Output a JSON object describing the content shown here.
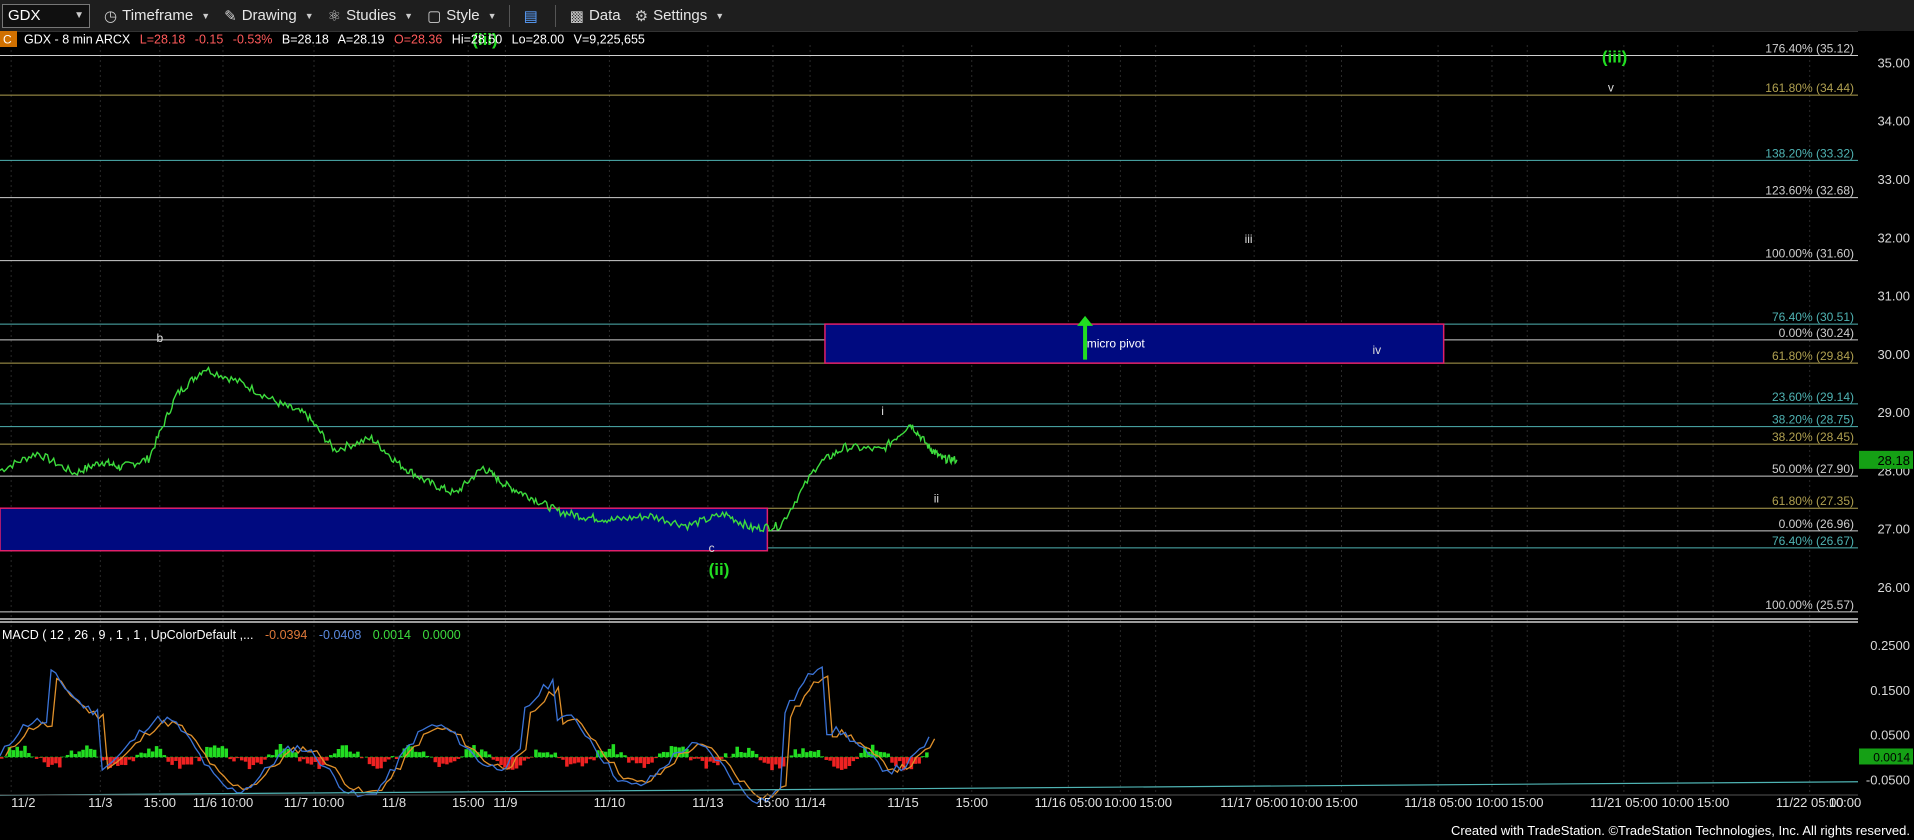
{
  "toolbar": {
    "symbol": "GDX",
    "items": [
      {
        "icon": "clock-icon",
        "label": "Timeframe"
      },
      {
        "icon": "pencil-icon",
        "label": "Drawing"
      },
      {
        "icon": "flask-icon",
        "label": "Studies"
      },
      {
        "icon": "style-icon",
        "label": "Style"
      },
      {
        "icon": "layout-icon",
        "label": ""
      },
      {
        "icon": "bar-chart-icon",
        "label": "Data"
      },
      {
        "icon": "gear-icon",
        "label": "Settings"
      }
    ]
  },
  "header": {
    "badge": "C",
    "symbol_text": "GDX - 8 min  ARCX",
    "last": "L=28.18",
    "change": "-0.15",
    "change_pct": "-0.53%",
    "bid": "B=28.18",
    "ask": "A=28.19",
    "open": "O=28.36",
    "high": "Hi=28.50",
    "low": "Lo=28.00",
    "volume": "V=9,225,655"
  },
  "macd": {
    "title": "MACD ( 12 , 26 , 9 , 1 , 1 , UpColorDefault ,...",
    "v1": "-0.0394",
    "v2": "-0.0408",
    "v3": "0.0014",
    "v4": "0.0000",
    "current_label": "0.0014",
    "ticks": [
      "0.2500",
      "0.1500",
      "0.0500",
      "-0.0500"
    ],
    "tick_values": [
      0.25,
      0.15,
      0.05,
      -0.05
    ]
  },
  "footer": "Created with TradeStation. ©TradeStation Technologies, Inc. All rights reserved.",
  "colors": {
    "price": "#3ddc3d",
    "macd_pos": "#22dd22",
    "macd_neg": "#ee2222",
    "macd_line": "#3b74d8",
    "signal_line": "#e0902a",
    "zone_fill": "#000a80",
    "zone_border": "#e0206a",
    "fib_teal": "#4fb3b3",
    "fib_gold": "#b0a050",
    "fib_white": "#cfcfcf"
  },
  "chart_data": {
    "type": "line",
    "title": "GDX - 8 min",
    "current_price": 28.18,
    "current_price_label": "28.18",
    "ylim": [
      25.5,
      35.3
    ],
    "y_ticks": [
      26.0,
      27.0,
      28.0,
      29.0,
      30.0,
      31.0,
      32.0,
      33.0,
      34.0,
      35.0
    ],
    "y_tick_labels": [
      "26.00",
      "27.00",
      "28.00",
      "29.00",
      "30.00",
      "31.00",
      "32.00",
      "33.00",
      "34.00",
      "35.00"
    ],
    "x_tick_labels": [
      "11/2",
      "11/3",
      "15:00",
      "11/6 10:00",
      "11/7 10:00",
      "11/8",
      "15:00",
      "11/9",
      "11/10",
      "11/13",
      "15:00",
      "11/14",
      "11/15",
      "15:00",
      "11/16 05:00",
      "10:00",
      "15:00",
      "11/17 05:00",
      "10:00",
      "15:00",
      "11/18 05:00",
      "10:00",
      "15:00",
      "11/21 05:00",
      "10:00",
      "15:00",
      "11/22 05:00",
      "10:00"
    ],
    "x_tick_positions": [
      0.006,
      0.054,
      0.086,
      0.12,
      0.169,
      0.212,
      0.252,
      0.272,
      0.328,
      0.381,
      0.416,
      0.436,
      0.486,
      0.523,
      0.575,
      0.603,
      0.622,
      0.675,
      0.703,
      0.722,
      0.774,
      0.803,
      0.822,
      0.874,
      0.903,
      0.922,
      0.974,
      1.003
    ],
    "series": [
      {
        "name": "GDX",
        "x": [
          0,
          0.02,
          0.04,
          0.055,
          0.065,
          0.08,
          0.095,
          0.11,
          0.13,
          0.15,
          0.165,
          0.18,
          0.2,
          0.215,
          0.23,
          0.245,
          0.26,
          0.272,
          0.285,
          0.3,
          0.315,
          0.33,
          0.35,
          0.37,
          0.39,
          0.405,
          0.42,
          0.44,
          0.455,
          0.475,
          0.49,
          0.5,
          0.507,
          0.515
        ],
        "y": [
          28.0,
          28.3,
          27.95,
          28.15,
          28.05,
          28.2,
          29.3,
          29.75,
          29.5,
          29.15,
          28.95,
          28.35,
          28.55,
          28.1,
          27.8,
          27.6,
          28.05,
          27.75,
          27.55,
          27.3,
          27.2,
          27.15,
          27.22,
          27.05,
          27.25,
          27.0,
          27.05,
          28.1,
          28.4,
          28.35,
          28.8,
          28.4,
          28.2,
          28.18
        ]
      }
    ],
    "fib_levels": [
      {
        "label": "176.40% (35.12)",
        "value": 35.12,
        "color": "fib_white"
      },
      {
        "label": "161.80% (34.44)",
        "value": 34.44,
        "color": "fib_gold"
      },
      {
        "label": "138.20% (33.32)",
        "value": 33.32,
        "color": "fib_teal"
      },
      {
        "label": "123.60% (32.68)",
        "value": 32.68,
        "color": "fib_white"
      },
      {
        "label": "100.00% (31.60)",
        "value": 31.6,
        "color": "fib_white"
      },
      {
        "label": "76.40% (30.51)",
        "value": 30.51,
        "color": "fib_teal"
      },
      {
        "label": "0.00% (30.24)",
        "value": 30.24,
        "color": "fib_white"
      },
      {
        "label": "61.80% (29.84)",
        "value": 29.84,
        "color": "fib_gold"
      },
      {
        "label": "23.60% (29.14)",
        "value": 29.14,
        "color": "fib_teal"
      },
      {
        "label": "38.20% (28.75)",
        "value": 28.75,
        "color": "fib_teal"
      },
      {
        "label": "38.20% (28.45)",
        "value": 28.45,
        "color": "fib_gold"
      },
      {
        "label": "50.00% (27.90)",
        "value": 27.9,
        "color": "fib_white"
      },
      {
        "label": "61.80% (27.35)",
        "value": 27.35,
        "color": "fib_gold"
      },
      {
        "label": "0.00% (26.96)",
        "value": 26.96,
        "color": "fib_white"
      },
      {
        "label": "76.40% (26.67)",
        "value": 26.67,
        "color": "fib_teal"
      },
      {
        "label": "100.00% (25.57)",
        "value": 25.57,
        "color": "fib_white"
      }
    ],
    "zones": [
      {
        "label": "",
        "x0": 0.0,
        "x1": 0.413,
        "y0": 26.62,
        "y1": 27.35
      },
      {
        "label": "micro pivot",
        "x0": 0.444,
        "x1": 0.777,
        "y0": 29.84,
        "y1": 30.51
      }
    ],
    "wave_labels": [
      {
        "text": "(iii)",
        "x": 0.261,
        "y": 35.3,
        "color": "#22dd22",
        "bold": true
      },
      {
        "text": "b",
        "x": 0.086,
        "y": 30.2,
        "color": "#dddddd"
      },
      {
        "text": "(ii)",
        "x": 0.387,
        "y": 26.2,
        "color": "#22dd22",
        "bold": true
      },
      {
        "text": "c",
        "x": 0.383,
        "y": 26.6,
        "color": "#dddddd"
      },
      {
        "text": "i",
        "x": 0.475,
        "y": 28.95,
        "color": "#dddddd"
      },
      {
        "text": "ii",
        "x": 0.504,
        "y": 27.45,
        "color": "#dddddd"
      },
      {
        "text": "iii",
        "x": 0.672,
        "y": 31.9,
        "color": "#dddddd"
      },
      {
        "text": "iv",
        "x": 0.741,
        "y": 30.0,
        "color": "#dddddd"
      },
      {
        "text": "(iii)",
        "x": 0.869,
        "y": 35.0,
        "color": "#22dd22",
        "bold": true
      },
      {
        "text": "v",
        "x": 0.867,
        "y": 34.5,
        "color": "#dddddd"
      }
    ],
    "arrow": {
      "x": 0.584,
      "y_from": 29.9,
      "y_to": 30.65
    }
  }
}
